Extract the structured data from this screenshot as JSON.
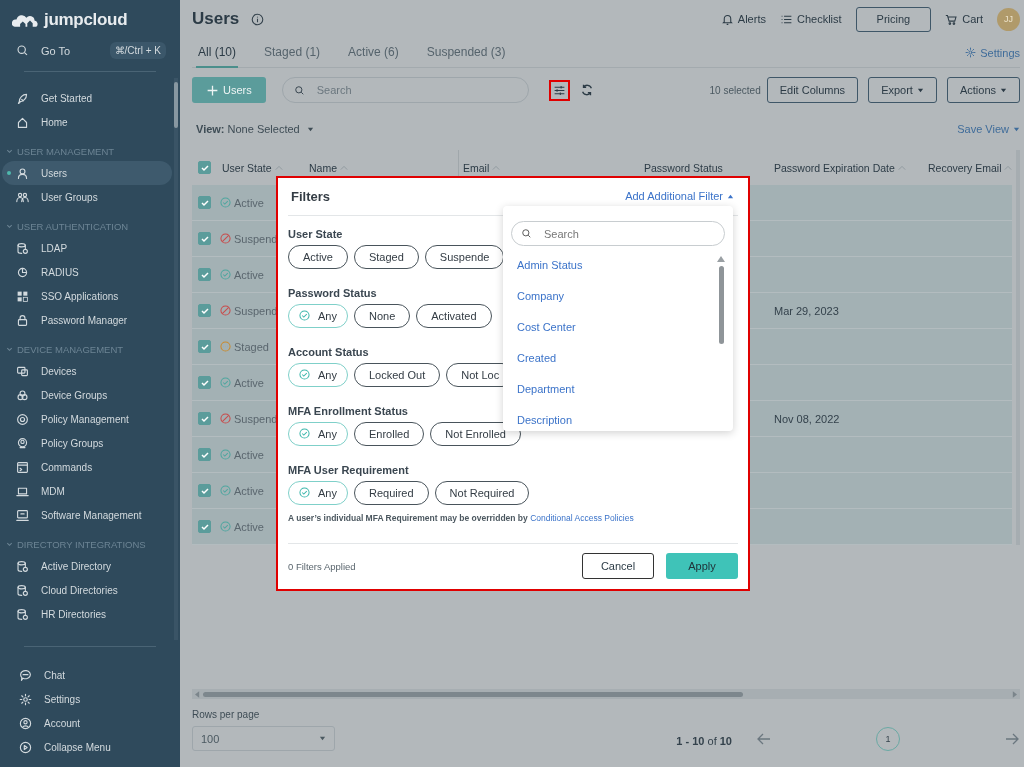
{
  "brand": {
    "name": "jumpcloud"
  },
  "sidebar": {
    "goto": {
      "label": "Go To",
      "shortcut": "⌘/Ctrl + K"
    },
    "top_items": [
      {
        "label": "Get Started",
        "selected": false
      },
      {
        "label": "Home",
        "selected": false
      }
    ],
    "sections": [
      {
        "title": "USER MANAGEMENT",
        "expanded": true,
        "items": [
          {
            "label": "Users",
            "selected": true
          },
          {
            "label": "User Groups",
            "selected": false
          }
        ]
      },
      {
        "title": "USER AUTHENTICATION",
        "expanded": true,
        "items": [
          {
            "label": "LDAP",
            "selected": false
          },
          {
            "label": "RADIUS",
            "selected": false
          },
          {
            "label": "SSO Applications",
            "selected": false
          },
          {
            "label": "Password Manager",
            "selected": false
          }
        ]
      },
      {
        "title": "DEVICE MANAGEMENT",
        "expanded": true,
        "items": [
          {
            "label": "Devices",
            "selected": false
          },
          {
            "label": "Device Groups",
            "selected": false
          },
          {
            "label": "Policy Management",
            "selected": false
          },
          {
            "label": "Policy Groups",
            "selected": false
          },
          {
            "label": "Commands",
            "selected": false
          },
          {
            "label": "MDM",
            "selected": false
          },
          {
            "label": "Software Management",
            "selected": false
          }
        ]
      },
      {
        "title": "DIRECTORY INTEGRATIONS",
        "expanded": true,
        "items": [
          {
            "label": "Active Directory",
            "selected": false
          },
          {
            "label": "Cloud Directories",
            "selected": false
          },
          {
            "label": "HR Directories",
            "selected": false
          }
        ]
      }
    ],
    "bottom_items": [
      {
        "label": "Chat"
      },
      {
        "label": "Settings"
      },
      {
        "label": "Account"
      },
      {
        "label": "Collapse Menu"
      }
    ]
  },
  "header": {
    "title": "Users",
    "alerts": "Alerts",
    "checklist": "Checklist",
    "pricing": "Pricing",
    "cart": "Cart",
    "avatar": "JJ"
  },
  "tabs": [
    {
      "label": "All (10)",
      "selected": true
    },
    {
      "label": "Staged (1)",
      "selected": false
    },
    {
      "label": "Active (6)",
      "selected": false
    },
    {
      "label": "Suspended (3)",
      "selected": false
    }
  ],
  "settings_link": "Settings",
  "toolbar": {
    "add_button": "Users",
    "search": {
      "placeholder": "Search"
    },
    "filter_highlighted": true,
    "selected_count": "10 selected",
    "edit_columns": "Edit Columns",
    "export": "Export",
    "actions": "Actions"
  },
  "view": {
    "label": "View:",
    "value": "None Selected",
    "save_view": "Save View"
  },
  "table": {
    "all_checked": true,
    "columns": [
      {
        "label": "User State",
        "sortable": true
      },
      {
        "label": "Name",
        "sortable": true
      },
      {
        "label": "Email",
        "sortable": true
      },
      {
        "label": "Password Status",
        "sortable": false
      },
      {
        "label": "Password Expiration Date",
        "sortable": true
      },
      {
        "label": "Recovery Email",
        "sortable": true
      }
    ],
    "rows": [
      {
        "checked": true,
        "state": "Active",
        "kind": "active"
      },
      {
        "checked": true,
        "state": "Suspend",
        "kind": "suspended"
      },
      {
        "checked": true,
        "state": "Active",
        "kind": "active"
      },
      {
        "checked": true,
        "state": "Suspend",
        "kind": "suspended",
        "expiration": "Mar 29, 2023"
      },
      {
        "checked": true,
        "state": "Staged",
        "kind": "staged"
      },
      {
        "checked": true,
        "state": "Active",
        "kind": "active"
      },
      {
        "checked": true,
        "state": "Suspend",
        "kind": "suspended",
        "expiration": "Nov 08, 2022"
      },
      {
        "checked": true,
        "state": "Active",
        "kind": "active"
      },
      {
        "checked": true,
        "state": "Active",
        "kind": "active"
      },
      {
        "checked": true,
        "state": "Active",
        "kind": "active"
      }
    ]
  },
  "footer": {
    "rows_per_page_label": "Rows per page",
    "rows_per_page": "100",
    "range": "**1 - 10** of **10**",
    "pages": [
      {
        "label": "1",
        "selected": true
      }
    ]
  },
  "filters": {
    "highlighted": true,
    "title": "Filters",
    "add_filter": "Add Additional Filter",
    "groups": [
      {
        "label": "User State",
        "options": [
          {
            "label": "Active",
            "selected": false
          },
          {
            "label": "Staged",
            "selected": false
          },
          {
            "label": "Suspende",
            "selected": false
          }
        ]
      },
      {
        "label": "Password Status",
        "options": [
          {
            "label": "Any",
            "selected": true
          },
          {
            "label": "None",
            "selected": false
          },
          {
            "label": "Activated",
            "selected": false
          }
        ]
      },
      {
        "label": "Account Status",
        "options": [
          {
            "label": "Any",
            "selected": true
          },
          {
            "label": "Locked Out",
            "selected": false
          },
          {
            "label": "Not Loc",
            "selected": false
          }
        ]
      },
      {
        "label": "MFA Enrollment Status",
        "options": [
          {
            "label": "Any",
            "selected": true
          },
          {
            "label": "Enrolled",
            "selected": false
          },
          {
            "label": "Not Enrolled",
            "selected": false
          }
        ]
      },
      {
        "label": "MFA User Requirement",
        "options": [
          {
            "label": "Any",
            "selected": true
          },
          {
            "label": "Required",
            "selected": false
          },
          {
            "label": "Not Required",
            "selected": false
          }
        ]
      }
    ],
    "note": {
      "text": "A user’s individual MFA Requirement may be overridden by",
      "link": "Conditional Access Policies"
    },
    "applied": "0 Filters Applied",
    "cancel": "Cancel",
    "apply": "Apply",
    "dropdown": {
      "search": {
        "placeholder": "Search"
      },
      "items": [
        "Admin Status",
        "Company",
        "Cost Center",
        "Created",
        "Department",
        "Description"
      ]
    }
  }
}
